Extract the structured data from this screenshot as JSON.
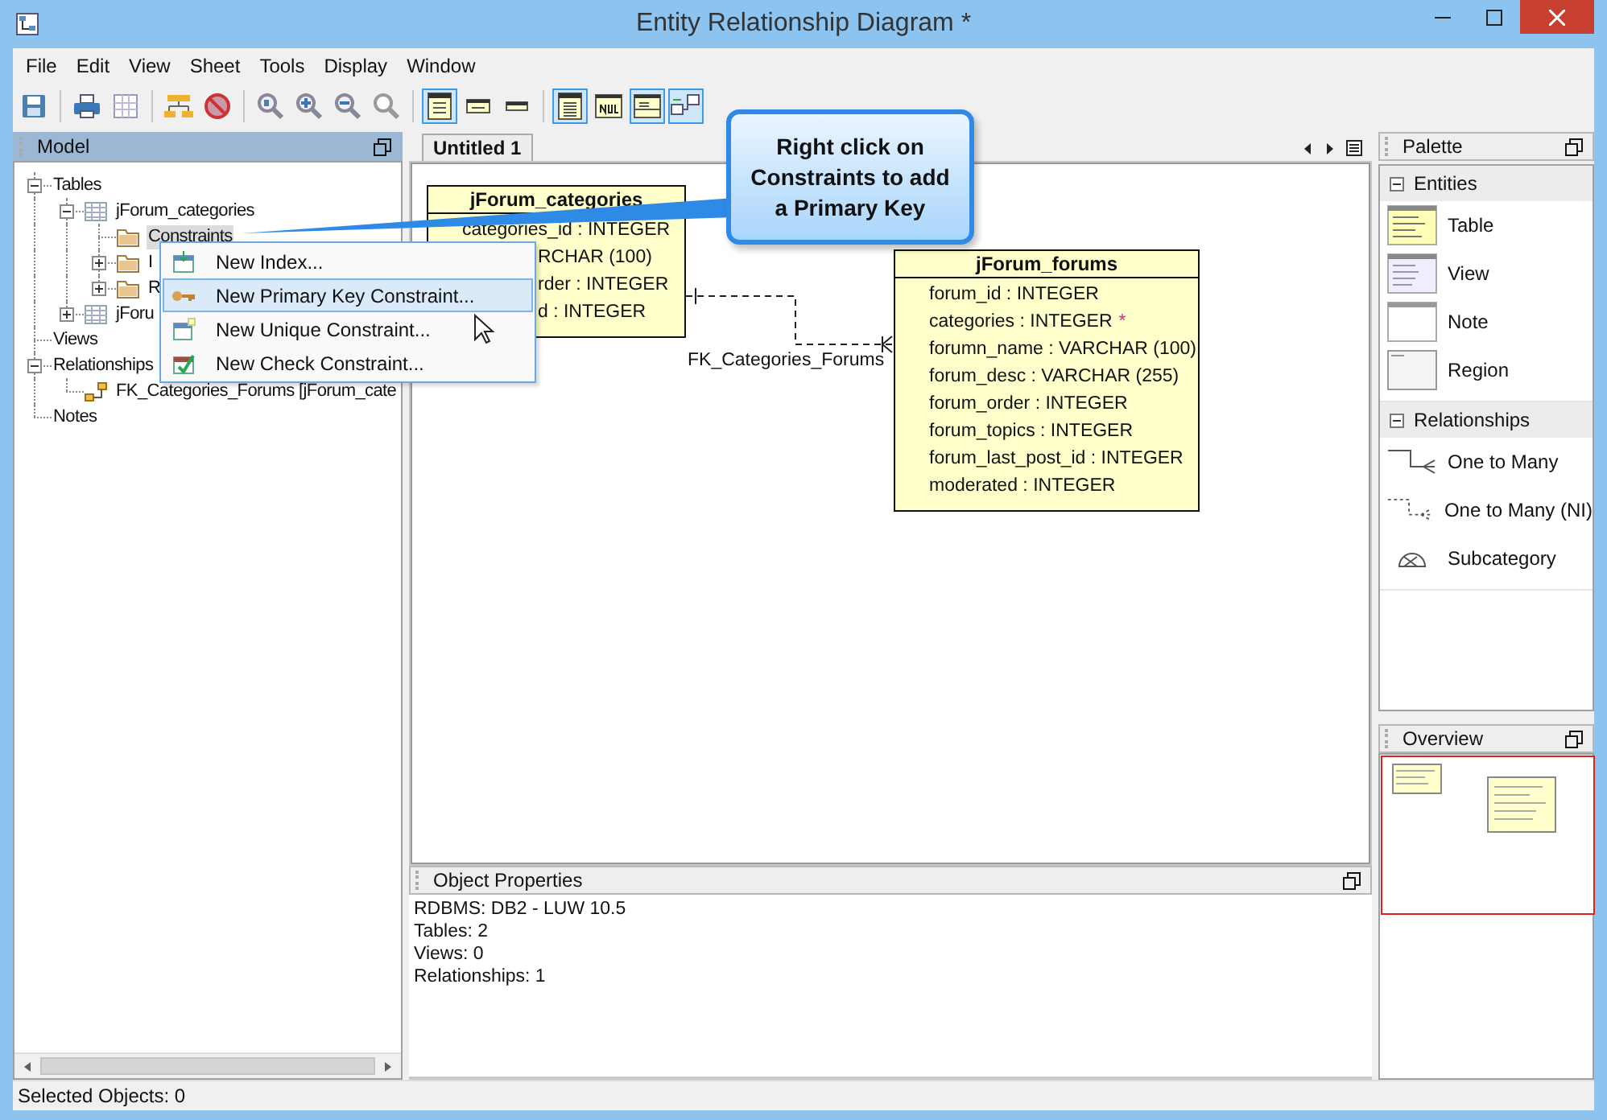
{
  "window": {
    "title": "Entity Relationship Diagram *"
  },
  "menu": [
    "File",
    "Edit",
    "View",
    "Sheet",
    "Tools",
    "Display",
    "Window"
  ],
  "toolbar": [
    [
      {
        "kind": "save",
        "pressed": false
      }
    ],
    [
      {
        "kind": "print",
        "pressed": false
      },
      {
        "kind": "grid",
        "pressed": false
      }
    ],
    [
      {
        "kind": "hierarchy",
        "pressed": false
      },
      {
        "kind": "stop",
        "pressed": false
      }
    ],
    [
      {
        "kind": "zoomfit",
        "pressed": false
      },
      {
        "kind": "zoomin",
        "pressed": false
      },
      {
        "kind": "zoomout",
        "pressed": false
      },
      {
        "kind": "zoom",
        "pressed": false
      }
    ],
    [
      {
        "kind": "full",
        "pressed": true
      },
      {
        "kind": "compact",
        "pressed": false
      },
      {
        "kind": "header",
        "pressed": false
      }
    ],
    [
      {
        "kind": "columns",
        "pressed": true
      },
      {
        "kind": "null",
        "pressed": false
      },
      {
        "kind": "name",
        "pressed": true
      },
      {
        "kind": "relation",
        "pressed": true
      }
    ]
  ],
  "model": {
    "title": "Model",
    "tree": [
      {
        "label": "Tables",
        "expanded": true,
        "selected": false,
        "children": [
          {
            "label": "jForum_categories",
            "kind": "table",
            "expanded": true,
            "selected": false,
            "children": [
              {
                "label": "Constraints",
                "kind": "folder",
                "selected": true
              },
              {
                "label": "I",
                "kind": "folder",
                "expanded": false,
                "selected": false
              },
              {
                "label": "R",
                "kind": "folder",
                "expanded": false,
                "selected": false
              }
            ]
          },
          {
            "label": "jForu",
            "kind": "table",
            "expanded": false,
            "selected": false
          }
        ]
      },
      {
        "label": "Views",
        "selected": false
      },
      {
        "label": "Relationships",
        "expanded": true,
        "selected": false,
        "children": [
          {
            "label": "FK_Categories_Forums [jForum_cate",
            "kind": "relation",
            "selected": false
          }
        ]
      },
      {
        "label": "Notes",
        "selected": false
      }
    ]
  },
  "context_menu": {
    "items": [
      {
        "label": "New Index...",
        "kind": "index",
        "selected": false
      },
      {
        "label": "New Primary Key Constraint...",
        "kind": "primary",
        "selected": true
      },
      {
        "label": "New Unique Constraint...",
        "kind": "unique",
        "selected": false
      },
      {
        "label": "New Check Constraint...",
        "kind": "check",
        "selected": false
      }
    ]
  },
  "callout": {
    "text": "Right click on Constraints to add a Primary Key"
  },
  "tabs": [
    {
      "label": "Untitled 1",
      "selected": true
    }
  ],
  "diagram": {
    "tables": [
      {
        "name": "jForum_categories",
        "rows": [
          {
            "text": "categories_id : INTEGER",
            "kind": "full"
          },
          {
            "text": "RCHAR (100)",
            "kind": "partial"
          },
          {
            "text": "rder : INTEGER",
            "kind": "partial"
          },
          {
            "text": "d : INTEGER",
            "kind": "partial"
          }
        ]
      },
      {
        "name": "jForum_forums",
        "rows": [
          {
            "text": "forum_id : INTEGER",
            "kind": "full"
          },
          {
            "text": "categories : INTEGER",
            "kind": "full",
            "suffix": "*"
          },
          {
            "text": "forumn_name : VARCHAR (100)",
            "kind": "full"
          },
          {
            "text": "forum_desc : VARCHAR (255)",
            "kind": "full"
          },
          {
            "text": "forum_order : INTEGER",
            "kind": "full"
          },
          {
            "text": "forum_topics : INTEGER",
            "kind": "full"
          },
          {
            "text": "forum_last_post_id : INTEGER",
            "kind": "full"
          },
          {
            "text": "moderated : INTEGER",
            "kind": "full"
          }
        ]
      }
    ],
    "relationships": [
      {
        "label": "FK_Categories_Forums"
      }
    ]
  },
  "object_properties": {
    "title": "Object Properties",
    "lines": [
      "RDBMS: DB2 - LUW 10.5",
      "Tables: 2",
      "Views: 0",
      "Relationships: 1"
    ]
  },
  "palette": {
    "title": "Palette",
    "sections": [
      {
        "title": "Entities",
        "expanded": true,
        "items": [
          {
            "label": "Table",
            "kind": "table"
          },
          {
            "label": "View",
            "kind": "view"
          },
          {
            "label": "Note",
            "kind": "note"
          },
          {
            "label": "Region",
            "kind": "region"
          }
        ]
      },
      {
        "title": "Relationships",
        "expanded": true,
        "items": [
          {
            "label": "One to Many",
            "kind": "onemany"
          },
          {
            "label": "One to Many (NI)",
            "kind": "onemanyni"
          },
          {
            "label": "Subcategory",
            "kind": "subcategory"
          }
        ]
      }
    ]
  },
  "overview": {
    "title": "Overview"
  },
  "status_bar": "Selected Objects: 0"
}
